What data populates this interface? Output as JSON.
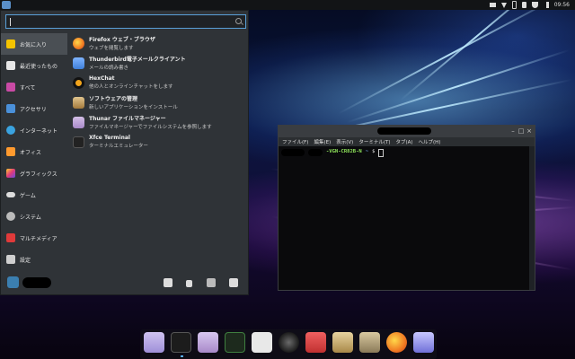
{
  "top_panel": {
    "clock": "09:56"
  },
  "menu": {
    "search": {
      "value": "",
      "placeholder": ""
    },
    "categories": [
      {
        "label": "お気に入り",
        "icon": "star-icon",
        "color": "#f5c400",
        "selected": true
      },
      {
        "label": "最近使ったもの",
        "icon": "clock-icon",
        "color": "#e6e6e6"
      },
      {
        "label": "すべて",
        "icon": "grid-icon",
        "color": "#c94aa5"
      },
      {
        "label": "アクセサリ",
        "icon": "accessories-icon",
        "color": "#4a90d9"
      },
      {
        "label": "インターネット",
        "icon": "cloud-icon",
        "color": "#3aa3e0"
      },
      {
        "label": "オフィス",
        "icon": "office-icon",
        "color": "#ff9a2e"
      },
      {
        "label": "グラフィックス",
        "icon": "graphics-icon",
        "color": "#b04ce0"
      },
      {
        "label": "ゲーム",
        "icon": "gamepad-icon",
        "color": "#dddddd"
      },
      {
        "label": "システム",
        "icon": "system-gear-icon",
        "color": "#bbbbbb"
      },
      {
        "label": "マルチメディア",
        "icon": "multimedia-icon",
        "color": "#e03a3a"
      },
      {
        "label": "設定",
        "icon": "settings-icon",
        "color": "#cfcfcf"
      }
    ],
    "apps": [
      {
        "name": "Firefox ウェブ・ブラウザ",
        "desc": "ウェブを閲覧します",
        "icon": "firefox-icon",
        "color": "#f07a22"
      },
      {
        "name": "Thunderbird電子メールクライアント",
        "desc": "メールの読み書き",
        "icon": "thunderbird-icon",
        "color": "#3f7fd8"
      },
      {
        "name": "HexChat",
        "desc": "他の人とオンラインチャットをします",
        "icon": "hexchat-icon",
        "color": "#f2a41b"
      },
      {
        "name": "ソフトウェアの管理",
        "desc": "新しいアプリケーションをインストール",
        "icon": "software-manager-icon",
        "color": "#c49a55"
      },
      {
        "name": "Thunar ファイルマネージャー",
        "desc": "ファイルマネージャーでファイルシステムを参照します",
        "icon": "thunar-icon",
        "color": "#a889c9"
      },
      {
        "name": "Xfce Terminal",
        "desc": "ターミナルエミュレーター",
        "icon": "terminal-icon",
        "color": "#222222"
      }
    ]
  },
  "terminal": {
    "menu": [
      "ファイル(F)",
      "編集(E)",
      "表示(V)",
      "ターミナル(T)",
      "タブ(A)",
      "ヘルプ(H)"
    ],
    "prompt_host": "-VGN-CR82B-N",
    "prompt_path": "~",
    "prompt_symbol": "$"
  }
}
